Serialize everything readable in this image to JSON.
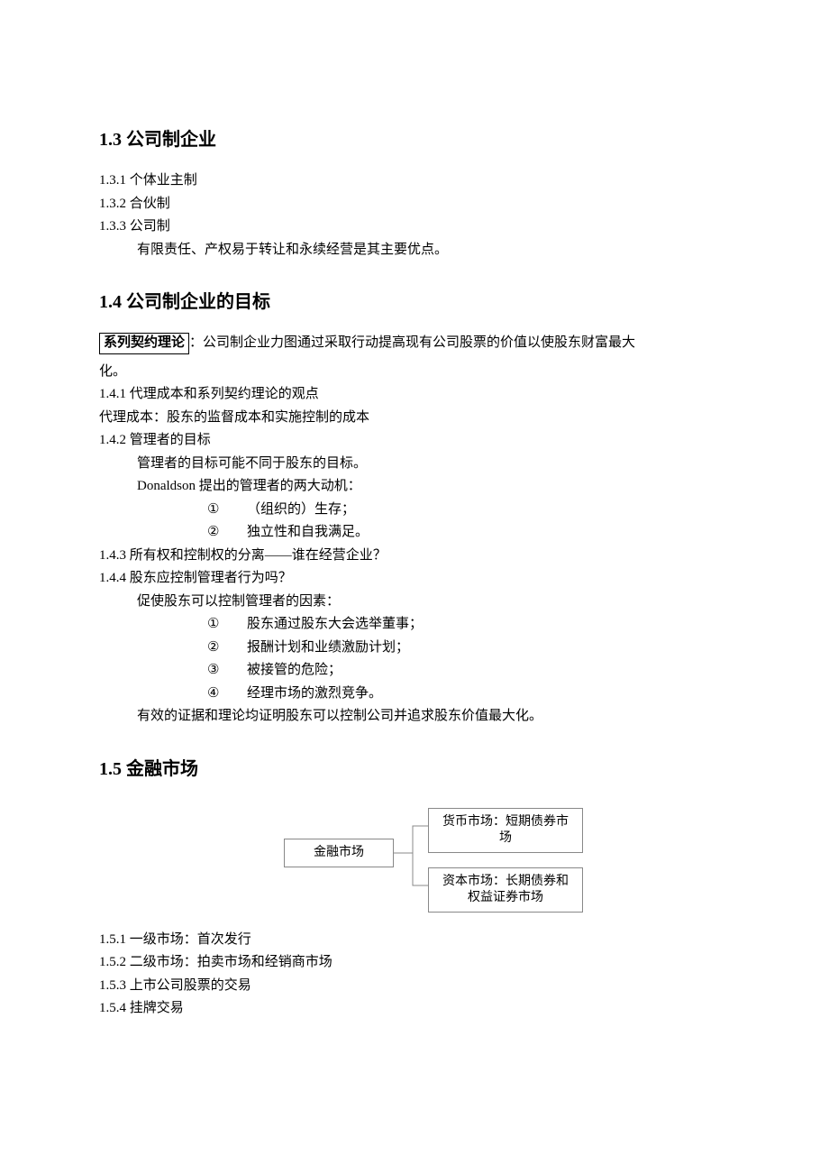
{
  "s13": {
    "title": "1.3 公司制企业",
    "i1": "1.3.1 个体业主制",
    "i2": "1.3.2 合伙制",
    "i3": "1.3.3 公司制",
    "i3note": "有限责任、产权易于转让和永续经营是其主要优点。"
  },
  "s14": {
    "title": "1.4 公司制企业的目标",
    "boxed": "系列契约理论",
    "boxed_after": "：公司制企业力图通过采取行动提高现有公司股票的价值以使股东财富最大",
    "boxed_line2": "化。",
    "i1": "1.4.1 代理成本和系列契约理论的观点",
    "i1note": "代理成本：股东的监督成本和实施控制的成本",
    "i2": "1.4.2 管理者的目标",
    "i2note1": "管理者的目标可能不同于股东的目标。",
    "i2note2": "Donaldson 提出的管理者的两大动机：",
    "i2s1n": "①",
    "i2s1": "（组织的）生存；",
    "i2s2n": "②",
    "i2s2": "独立性和自我满足。",
    "i3": "1.4.3 所有权和控制权的分离——谁在经营企业？",
    "i4": "1.4.4 股东应控制管理者行为吗？",
    "i4note": "促使股东可以控制管理者的因素：",
    "i4s1n": "①",
    "i4s1": "股东通过股东大会选举董事；",
    "i4s2n": "②",
    "i4s2": "报酬计划和业绩激励计划；",
    "i4s3n": "③",
    "i4s3": "被接管的危险；",
    "i4s4n": "④",
    "i4s4": "经理市场的激烈竞争。",
    "i4end": "有效的证据和理论均证明股东可以控制公司并追求股东价值最大化。"
  },
  "s15": {
    "title": "1.5 金融市场",
    "diagram": {
      "root": "金融市场",
      "child1": "货币市场：短期债券市场",
      "child2": "资本市场：长期债券和权益证券市场"
    },
    "i1": "1.5.1 一级市场：首次发行",
    "i2": "1.5.2 二级市场：拍卖市场和经销商市场",
    "i3": "1.5.3 上市公司股票的交易",
    "i4": "1.5.4 挂牌交易"
  }
}
